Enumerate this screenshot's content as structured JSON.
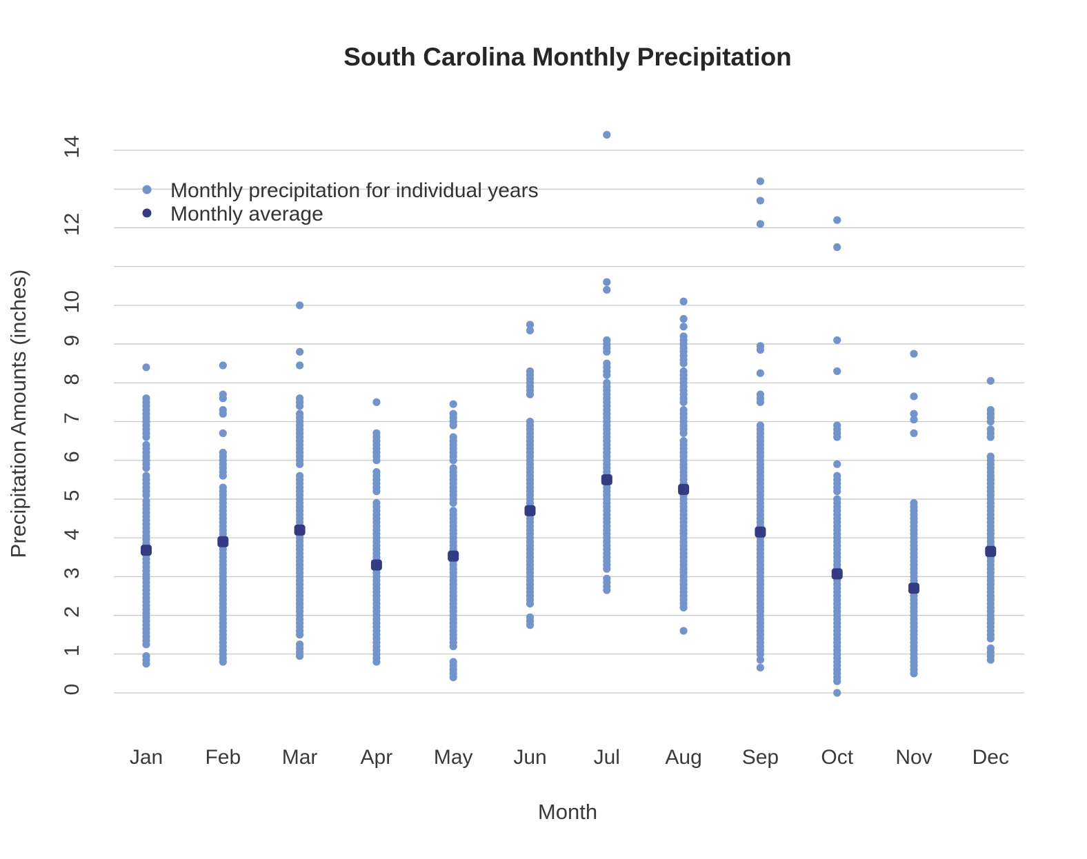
{
  "chart_data": {
    "type": "scatter",
    "title": "South Carolina Monthly Precipitation",
    "xlabel": "Month",
    "ylabel": "Precipitation Amounts (inches)",
    "categories": [
      "Jan",
      "Feb",
      "Mar",
      "Apr",
      "May",
      "Jun",
      "Jul",
      "Aug",
      "Sep",
      "Oct",
      "Nov",
      "Dec"
    ],
    "ylim": [
      0,
      14
    ],
    "yticks": [
      0,
      1,
      2,
      3,
      4,
      5,
      6,
      7,
      8,
      9,
      10,
      12,
      14
    ],
    "ygrid": [
      0,
      1,
      2,
      3,
      4,
      5,
      6,
      7,
      8,
      9,
      10,
      11,
      12,
      13,
      14
    ],
    "grid": true,
    "legend": {
      "placement": "top-left",
      "entries": [
        {
          "label": "Monthly precipitation for individual years",
          "color": "#7393cb"
        },
        {
          "label": "Monthly average",
          "color": "#343b82"
        }
      ]
    },
    "colors": {
      "individual": "#7393cb",
      "average": "#343b82"
    },
    "series": [
      {
        "name": "Monthly precipitation for individual years",
        "ranges": [
          [
            [
              0.75,
              0.95
            ],
            [
              1.25,
              4.95
            ],
            [
              5.1,
              5.6
            ],
            [
              5.8,
              6.4
            ],
            [
              6.6,
              6.9
            ],
            [
              7.0,
              7.6
            ]
          ],
          [
            [
              0.8,
              3.8
            ],
            [
              3.9,
              5.3
            ],
            [
              5.6,
              6.2
            ],
            [
              6.7,
              6.7
            ],
            [
              7.2,
              7.3
            ],
            [
              7.6,
              7.7
            ]
          ],
          [
            [
              0.95,
              1.3
            ],
            [
              1.5,
              5.6
            ],
            [
              5.9,
              6.4
            ],
            [
              6.5,
              7.0
            ],
            [
              7.1,
              7.2
            ],
            [
              7.4,
              7.6
            ]
          ],
          [
            [
              0.8,
              1.1
            ],
            [
              1.2,
              4.9
            ],
            [
              5.2,
              5.7
            ],
            [
              6.0,
              6.5
            ],
            [
              6.6,
              6.75
            ]
          ],
          [
            [
              0.4,
              0.85
            ],
            [
              1.2,
              4.75
            ],
            [
              4.9,
              5.8
            ],
            [
              6.0,
              6.6
            ],
            [
              6.9,
              7.2
            ]
          ],
          [
            [
              1.75,
              2.0
            ],
            [
              2.3,
              6.5
            ],
            [
              6.6,
              7.0
            ],
            [
              7.7,
              8.3
            ]
          ],
          [
            [
              2.65,
              3.0
            ],
            [
              3.2,
              8.0
            ],
            [
              8.2,
              8.5
            ],
            [
              8.8,
              9.1
            ]
          ],
          [
            [
              2.2,
              6.5
            ],
            [
              6.7,
              7.3
            ],
            [
              7.5,
              8.3
            ],
            [
              8.5,
              9.2
            ]
          ],
          [
            [
              1.0,
              6.0
            ],
            [
              6.1,
              6.9
            ],
            [
              7.5,
              7.7
            ]
          ],
          [
            [
              0.3,
              5.0
            ],
            [
              5.2,
              5.6
            ],
            [
              5.9,
              5.9
            ],
            [
              6.6,
              6.9
            ]
          ],
          [
            [
              0.5,
              4.95
            ]
          ],
          [
            [
              0.85,
              1.15
            ],
            [
              1.4,
              6.1
            ],
            [
              6.6,
              6.8
            ],
            [
              7.0,
              7.3
            ]
          ]
        ],
        "outliers": [
          [
            8.4
          ],
          [
            8.45
          ],
          [
            8.45,
            8.8,
            10.0
          ],
          [
            7.5
          ],
          [
            7.45
          ],
          [
            9.35,
            9.5
          ],
          [
            10.4,
            10.6,
            14.4
          ],
          [
            1.6,
            9.45,
            9.65,
            10.1
          ],
          [
            0.65,
            0.85,
            8.25,
            8.85,
            8.95,
            12.1,
            12.7,
            13.2
          ],
          [
            0.0,
            8.3,
            9.1,
            11.5,
            12.2
          ],
          [
            6.7,
            7.05,
            7.2,
            7.65,
            8.75
          ],
          [
            8.05
          ]
        ]
      },
      {
        "name": "Monthly average",
        "values": [
          3.68,
          3.9,
          4.2,
          3.3,
          3.53,
          4.7,
          5.5,
          5.25,
          4.15,
          3.07,
          2.7,
          3.65
        ]
      }
    ]
  }
}
